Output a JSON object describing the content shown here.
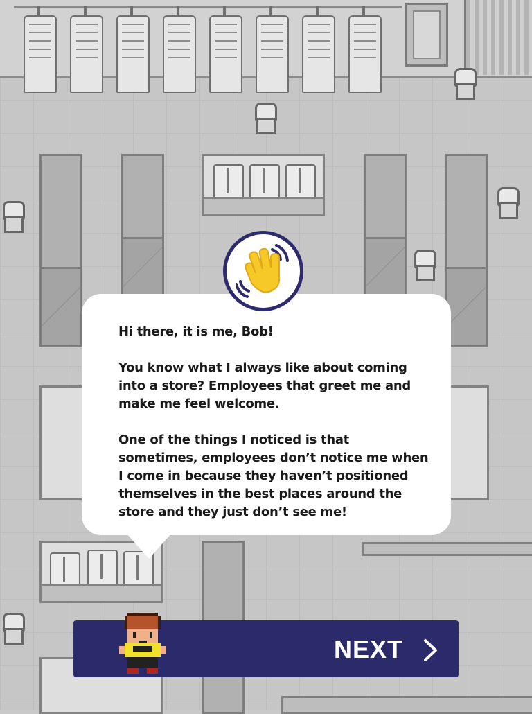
{
  "scene": {
    "name": "clothing-store-floor"
  },
  "dialog": {
    "speaker_icon": "waving-hand-icon",
    "paragraphs": [
      "Hi there, it is me, Bob!",
      "You know what I always like about coming into a store?  Employees that greet me and make me feel welcome.",
      "One of the things I noticed is that sometimes, employees don’t notice me when I come in because they haven’t positioned themselves in the best places around the store and they just don’t see me!"
    ]
  },
  "next_button": {
    "label": "NEXT",
    "icon": "chevron-right-icon",
    "avatar": "bob-pixel-avatar"
  },
  "colors": {
    "button_bg": "#2b2a6b",
    "badge_border": "#2e2a6e",
    "wave_hand": "#f6c928",
    "bubble": "#ffffff",
    "floor": "#c6c6c6"
  }
}
